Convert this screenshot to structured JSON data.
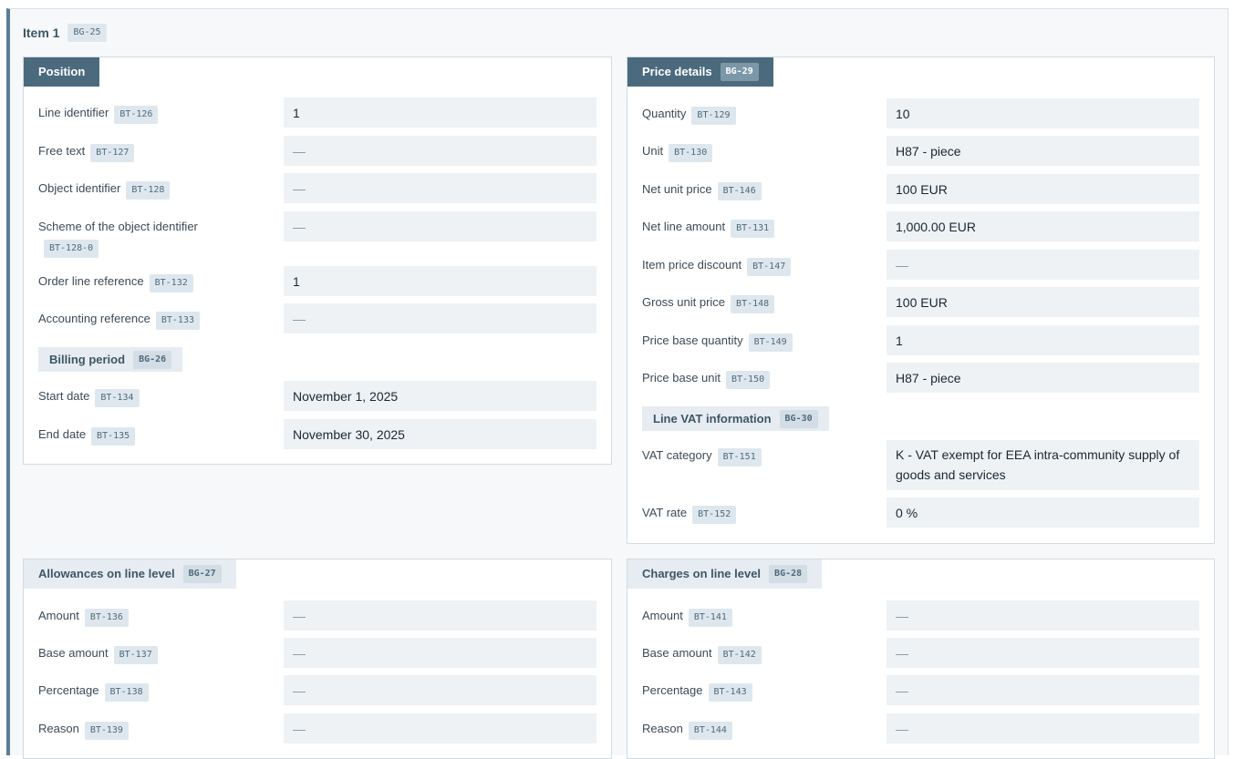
{
  "item": {
    "title": "Item 1",
    "code": "BG-25"
  },
  "position": {
    "title": "Position",
    "rows": [
      {
        "label": "Line identifier",
        "code": "BT-126",
        "value": "1"
      },
      {
        "label": "Free text",
        "code": "BT-127",
        "value": "—"
      },
      {
        "label": "Object identifier",
        "code": "BT-128",
        "value": "—"
      },
      {
        "label": "Scheme of the object identifier",
        "code": "BT-128-0",
        "value": "—"
      },
      {
        "label": "Order line reference",
        "code": "BT-132",
        "value": "1"
      },
      {
        "label": "Accounting reference",
        "code": "BT-133",
        "value": "—"
      }
    ],
    "billing": {
      "title": "Billing period",
      "code": "BG-26",
      "rows": [
        {
          "label": "Start date",
          "code": "BT-134",
          "value": "November 1, 2025"
        },
        {
          "label": "End date",
          "code": "BT-135",
          "value": "November 30, 2025"
        }
      ]
    }
  },
  "price": {
    "title": "Price details",
    "code": "BG-29",
    "rows": [
      {
        "label": "Quantity",
        "code": "BT-129",
        "value": "10"
      },
      {
        "label": "Unit",
        "code": "BT-130",
        "value": "H87 - piece"
      },
      {
        "label": "Net unit price",
        "code": "BT-146",
        "value": "100 EUR"
      },
      {
        "label": "Net line amount",
        "code": "BT-131",
        "value": "1,000.00 EUR"
      },
      {
        "label": "Item price discount",
        "code": "BT-147",
        "value": "—"
      },
      {
        "label": "Gross unit price",
        "code": "BT-148",
        "value": "100 EUR"
      },
      {
        "label": "Price base quantity",
        "code": "BT-149",
        "value": "1"
      },
      {
        "label": "Price base unit",
        "code": "BT-150",
        "value": "H87 - piece"
      }
    ],
    "vat": {
      "title": "Line VAT information",
      "code": "BG-30",
      "rows": [
        {
          "label": "VAT category",
          "code": "BT-151",
          "value": "K - VAT exempt for EEA intra-community supply of goods and services"
        },
        {
          "label": "VAT rate",
          "code": "BT-152",
          "value": "0 %"
        }
      ]
    }
  },
  "allowances": {
    "title": "Allowances on line level",
    "code": "BG-27",
    "rows": [
      {
        "label": "Amount",
        "code": "BT-136",
        "value": "—"
      },
      {
        "label": "Base amount",
        "code": "BT-137",
        "value": "—"
      },
      {
        "label": "Percentage",
        "code": "BT-138",
        "value": "—"
      },
      {
        "label": "Reason",
        "code": "BT-139",
        "value": "—"
      }
    ]
  },
  "charges": {
    "title": "Charges on line level",
    "code": "BG-28",
    "rows": [
      {
        "label": "Amount",
        "code": "BT-141",
        "value": "—"
      },
      {
        "label": "Base amount",
        "code": "BT-142",
        "value": "—"
      },
      {
        "label": "Percentage",
        "code": "BT-143",
        "value": "—"
      },
      {
        "label": "Reason",
        "code": "BT-144",
        "value": "—"
      }
    ]
  }
}
